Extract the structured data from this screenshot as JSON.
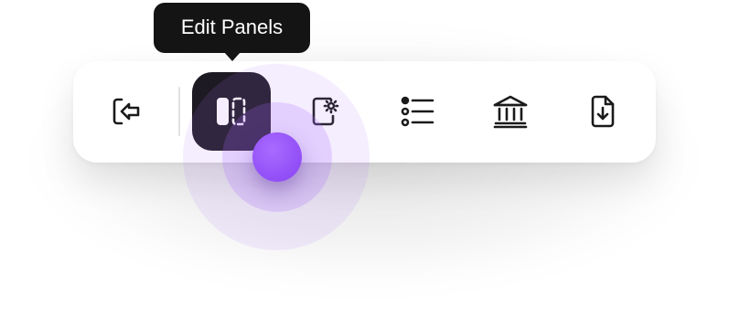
{
  "tooltip": {
    "text": "Edit Panels"
  },
  "toolbar": {
    "buttons": [
      {
        "icon": "exit-icon",
        "active": false
      },
      {
        "icon": "edit-panels-icon",
        "active": true
      },
      {
        "icon": "panel-settings-icon",
        "active": false
      },
      {
        "icon": "list-icon",
        "active": false
      },
      {
        "icon": "bank-icon",
        "active": false
      },
      {
        "icon": "file-download-icon",
        "active": false
      }
    ]
  },
  "colors": {
    "active_button_bg": "#1e1a23",
    "tooltip_bg": "#141414",
    "cursor_accent": "#9552f8",
    "icon_color": "#1a1a1a"
  }
}
